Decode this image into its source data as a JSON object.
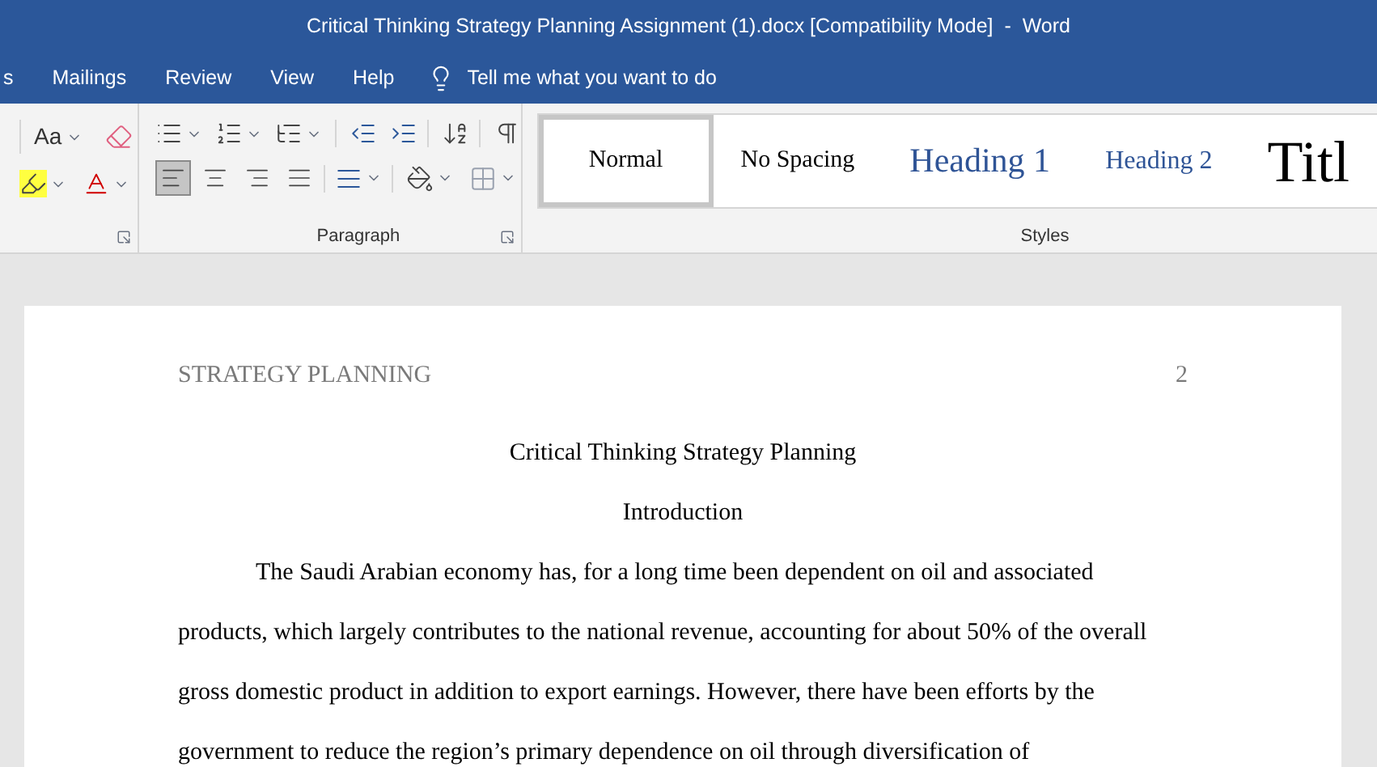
{
  "window": {
    "title": "Critical Thinking Strategy Planning Assignment (1).docx [Compatibility Mode]  -  Word"
  },
  "ribbon_tabs": [
    {
      "label": "s"
    },
    {
      "label": "Mailings"
    },
    {
      "label": "Review"
    },
    {
      "label": "View"
    },
    {
      "label": "Help"
    }
  ],
  "tell_me": {
    "placeholder": "Tell me what you want to do"
  },
  "font_group": {
    "change_case": "Aa"
  },
  "paragraph_group": {
    "label": "Paragraph",
    "alignment": [
      {
        "kind": "left",
        "selected": true
      },
      {
        "kind": "center",
        "selected": false
      },
      {
        "kind": "right",
        "selected": false
      },
      {
        "kind": "justify",
        "selected": false
      }
    ]
  },
  "styles_group": {
    "label": "Styles",
    "styles": [
      {
        "kind": "normal",
        "label": "Normal",
        "selected": true
      },
      {
        "kind": "nospacing",
        "label": "No Spacing",
        "selected": false
      },
      {
        "kind": "heading1",
        "label": "Heading 1",
        "selected": false
      },
      {
        "kind": "heading2",
        "label": "Heading 2",
        "selected": false
      },
      {
        "kind": "title",
        "label": "Titl",
        "selected": false
      }
    ]
  },
  "document": {
    "header": "STRATEGY PLANNING",
    "page_number": "2",
    "title": "Critical Thinking Strategy Planning",
    "heading": "Introduction",
    "paragraph": "The Saudi Arabian economy has, for a long time been dependent on oil and associated products, which largely contributes to the national revenue, accounting for about 50% of the overall gross domestic product in addition to export earnings. However, there have been efforts by the government to reduce the region’s primary dependence on oil through diversification of"
  }
}
